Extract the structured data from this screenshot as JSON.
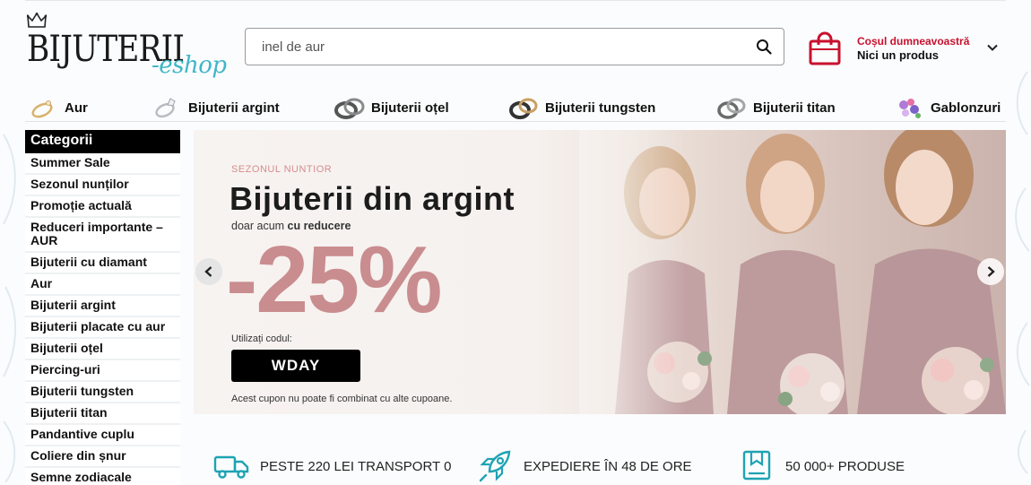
{
  "header": {
    "logo_main": "BIJUTERII",
    "logo_suffix": "-eshop",
    "search": {
      "value": "",
      "placeholder": "inel de aur",
      "icon": "search-icon"
    },
    "cart": {
      "title": "Coșul dumneavoastră",
      "subtitle": "Nici un produs",
      "icon": "shopping-bag-icon"
    }
  },
  "category_strip": [
    {
      "label": "Aur",
      "icon": "gold-ring-icon"
    },
    {
      "label": "Bijuterii argint",
      "icon": "silver-ring-icon"
    },
    {
      "label": "Bijuterii oțel",
      "icon": "steel-ring-icon"
    },
    {
      "label": "Bijuterii tungsten",
      "icon": "tungsten-ring-icon"
    },
    {
      "label": "Bijuterii titan",
      "icon": "titanium-ring-icon"
    },
    {
      "label": "Gablonzuri",
      "icon": "gablonz-jewelry-icon"
    }
  ],
  "sidebar": {
    "title": "Categorii",
    "items": [
      "Summer Sale",
      "Sezonul nunților",
      "Promoție actuală",
      "Reduceri importante – AUR",
      "Bijuterii cu diamant",
      "Aur",
      "Bijuterii argint",
      "Bijuterii placate cu aur",
      "Bijuterii oțel",
      "Piercing-uri",
      "Bijuterii tungsten",
      "Bijuterii titan",
      "Pandantive cuplu",
      "Coliere din șnur",
      "Semne zodiacale"
    ]
  },
  "banner": {
    "season": "SEZONUL NUNTIOR",
    "headline": "Bijuterii din argint",
    "sub_prefix": "doar acum ",
    "sub_bold": "cu reducere",
    "discount": "-25%",
    "use_code_label": "Utilizați codul:",
    "code": "WDAY",
    "note": "Acest cupon nu poate fi combinat cu alte cupoane."
  },
  "features": [
    {
      "label": "PESTE 220 LEI TRANSPORT 0",
      "icon": "delivery-truck-icon"
    },
    {
      "label": "EXPEDIERE ÎN 48 DE ORE",
      "icon": "rocket-icon"
    },
    {
      "label": "50 000+ PRODUSE",
      "icon": "bookmark-box-icon"
    }
  ],
  "colors": {
    "accent_red": "#c8102e",
    "teal": "#3fb6c9",
    "discount_pink": "#c98d8f"
  }
}
